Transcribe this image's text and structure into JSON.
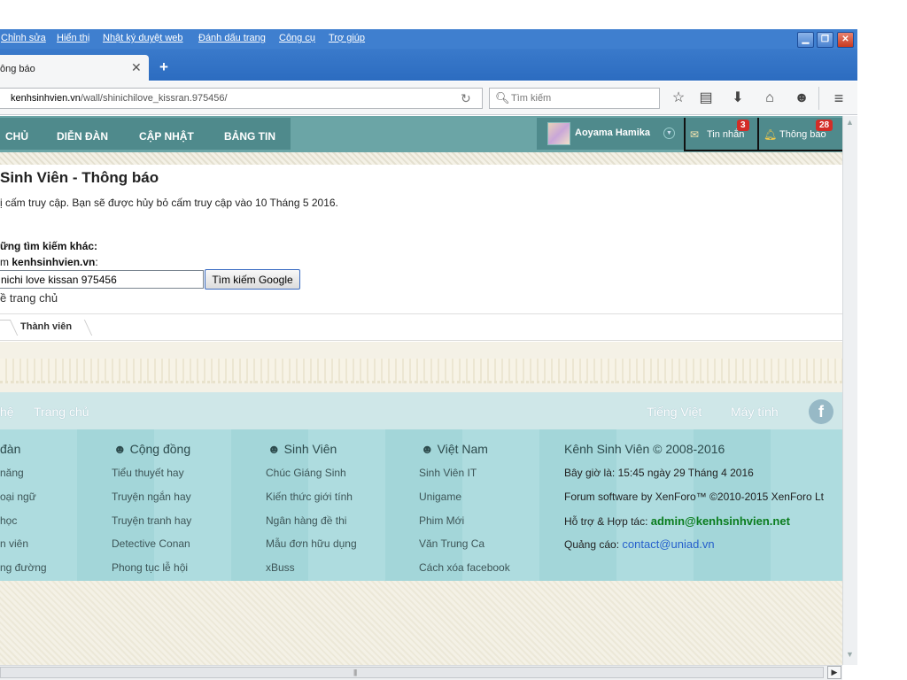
{
  "browser": {
    "menu": [
      "Chỉnh sửa",
      "Hiển thị",
      "Nhật ký duyệt web",
      "Đánh dấu trang",
      "Công cụ",
      "Trợ giúp"
    ],
    "window_buttons": {
      "minimize": "▁",
      "restore": "❐",
      "close": "✕"
    },
    "tab": {
      "title": "ông báo",
      "close": "✕"
    },
    "new_tab": "+",
    "url": {
      "host": "kenhsinhvien.vn",
      "path": "/wall/shinichilove_kissran.975456/"
    },
    "search_placeholder": "Tìm kiếm",
    "icons": [
      "reload-icon",
      "search-icon",
      "bookmark-star-icon",
      "reading-list-icon",
      "download-icon",
      "home-icon",
      "chat-icon",
      "menu-icon"
    ]
  },
  "forum": {
    "nav_tabs": [
      "CHỦ",
      "DIỄN ĐÀN",
      "CẬP NHẬT",
      "BẢNG TIN"
    ],
    "user": {
      "name": "Aoyama Hamika"
    },
    "alerts": [
      {
        "label": "Tin nhắn",
        "count": "3"
      },
      {
        "label": "Thông báo",
        "count": "28"
      }
    ]
  },
  "content": {
    "title": "Sinh Viên - Thông báo",
    "ban_message": "ị cấm truy cập. Bạn sẽ được hủy bỏ cấm truy cập vào 10 Tháng 5 2016.",
    "other_search": "ững tìm kiếm khác:",
    "search_in_prefix": "m ",
    "search_in_site": "kenhsinhvien.vn",
    "search_in_suffix": ":",
    "google_query": "nichi love kissan 975456",
    "google_button": "Tìm kiếm Google",
    "home_link": "ề trang chủ",
    "breadcrumb": "Thành viên"
  },
  "footer": {
    "links_left": [
      "hệ",
      "Trang chủ"
    ],
    "links_right": [
      "Tiếng Việt",
      "Máy tính"
    ],
    "facebook": "f",
    "columns": [
      {
        "title": "đàn",
        "items": [
          "năng",
          "oại ngữ",
          "học",
          "n viên",
          "ng đường"
        ]
      },
      {
        "title": "Cộng đồng",
        "items": [
          "Tiểu thuyết hay",
          "Truyện ngắn hay",
          "Truyện tranh hay",
          "Detective Conan",
          "Phong tục lễ hội"
        ]
      },
      {
        "title": "Sinh Viên",
        "items": [
          "Chúc Giáng Sinh",
          "Kiến thức giới tính",
          "Ngân hàng đề thi",
          "Mẫu đơn hữu dụng",
          "xBuss"
        ]
      },
      {
        "title": "Việt Nam",
        "items": [
          "Sinh Viên IT",
          "Unigame",
          "Phim Mới",
          "Văn Trung Ca",
          "Cách xóa facebook"
        ]
      }
    ],
    "brand": "Kênh Sinh Viên © 2008-2016",
    "time_line": "Bây giờ là: 15:45 ngày 29 Tháng 4 2016",
    "software_line": "Forum software by XenForo™ ©2010-2015 XenForo Lt",
    "support_label": "Hỗ trợ & Hợp tác: ",
    "support_email": "admin@kenhsinhvien.net",
    "ads_label": "Quảng cáo: ",
    "ads_email": "contact@uniad.vn"
  },
  "colors": {
    "menubar": "#3f7fcf",
    "forum_nav": "#6ba5a6",
    "badge": "#d32d27",
    "footer": "#aedcdf",
    "admin_email": "#0a7d1e",
    "contact_email": "#2660cc"
  }
}
